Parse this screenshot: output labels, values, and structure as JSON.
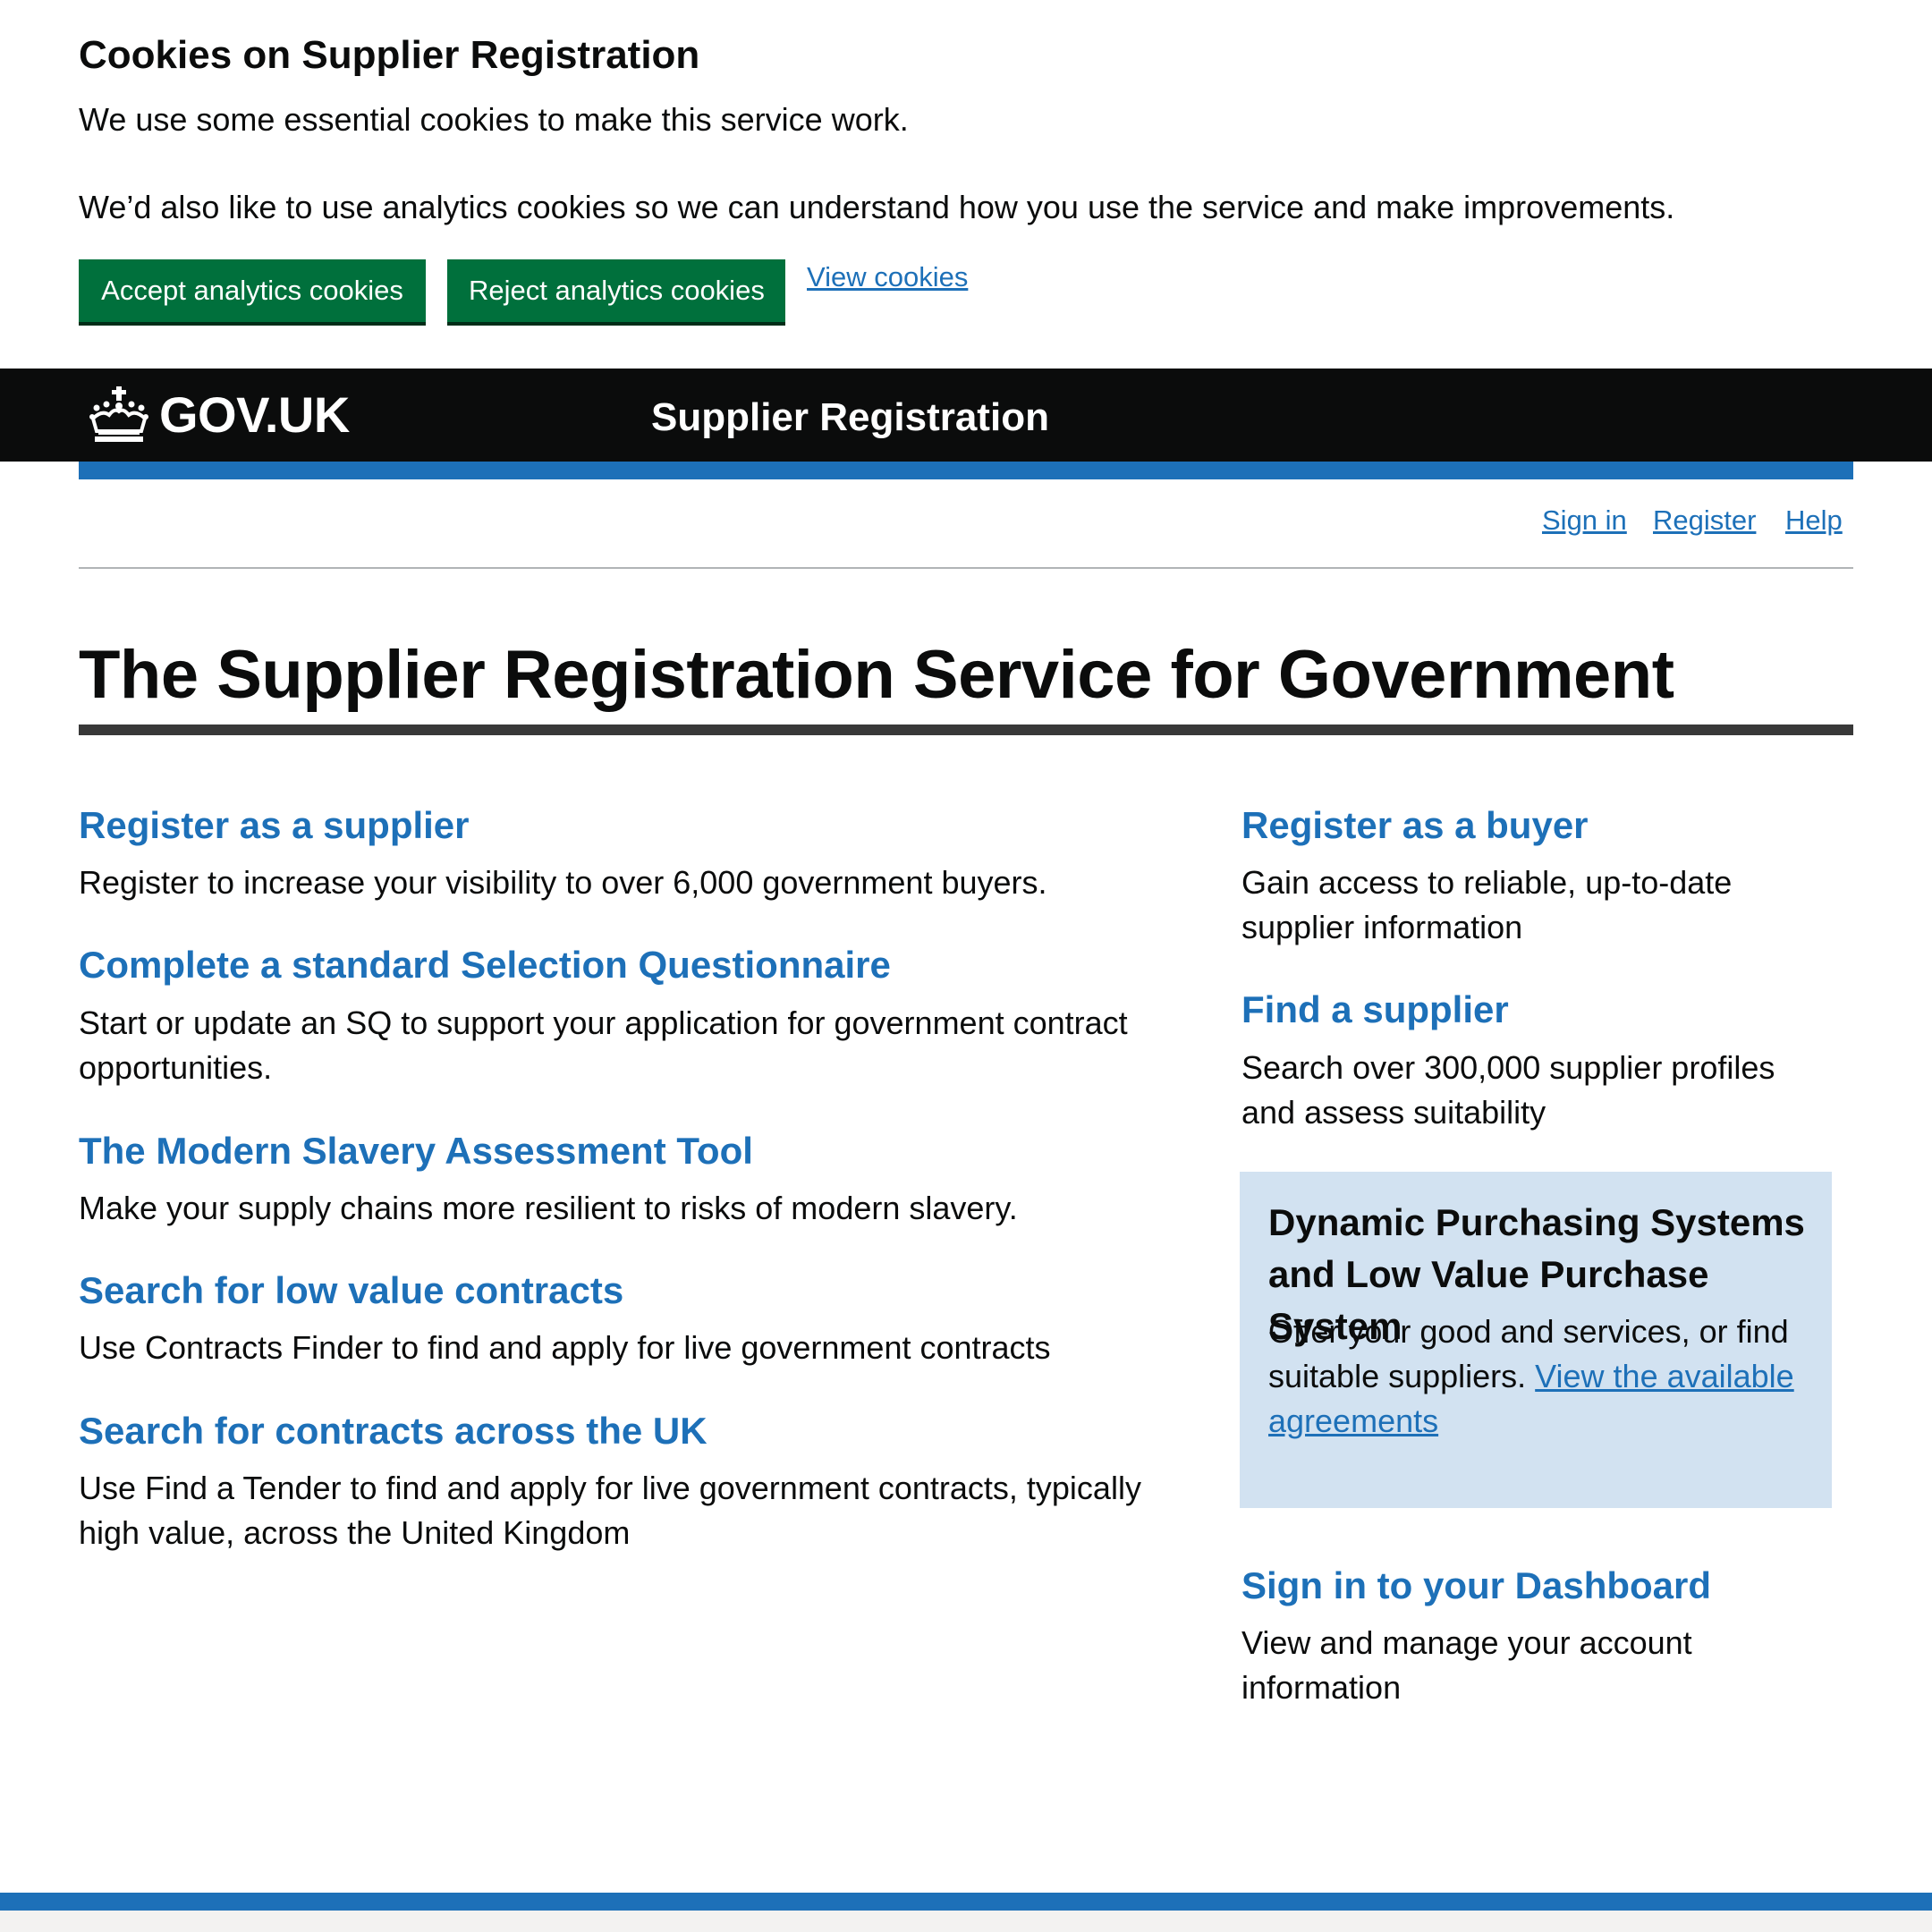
{
  "cookie_banner": {
    "title": "Cookies on Supplier Registration",
    "paragraph_1": "We use some essential cookies to make this service work.",
    "paragraph_2": "We’d also like to use analytics cookies so we can understand how you use the service and make improvements.",
    "accept_label": "Accept analytics cookies",
    "reject_label": "Reject analytics cookies",
    "view_label": "View cookies"
  },
  "header": {
    "logo_text": "GOV.UK",
    "logo_icon": "crown-icon",
    "service_name": "Supplier Registration"
  },
  "nav": {
    "sign_in": "Sign in",
    "register": "Register",
    "help": "Help"
  },
  "main": {
    "title": "The Supplier Registration Service for Government",
    "left": [
      {
        "heading": "Register as a supplier",
        "description": "Register to increase your visibility to over 6,000 government buyers."
      },
      {
        "heading": "Complete a standard Selection Questionnaire",
        "description_1": "Start or update an SQ to support your application for government contract",
        "description_2": "opportunities."
      },
      {
        "heading": "The Modern Slavery Assessment Tool",
        "description": "Make your supply chains more resilient to risks of modern slavery."
      },
      {
        "heading": "Search for low value contracts",
        "description": "Use Contracts Finder to find and apply for live government contracts"
      },
      {
        "heading": "Search for contracts across the UK",
        "description_1": "Use Find a Tender to find and apply for live government contracts, typically",
        "description_2": "high value, across the United Kingdom"
      }
    ],
    "right": [
      {
        "heading": "Register as a buyer",
        "description_1": "Gain access to reliable, up-to-date",
        "description_2": "supplier information"
      },
      {
        "heading": "Find a supplier",
        "description_1": "Search over 300,000 supplier profiles",
        "description_2": "and assess suitability"
      },
      {
        "heading": "Sign in to your Dashboard",
        "description_1": "View and manage your account",
        "description_2": "information"
      }
    ],
    "dps_panel": {
      "title": "Dynamic Purchasing Systems and Low Value Purchase System",
      "text": "Offer your good and services, or find suitable suppliers. ",
      "link": "View the available agreements"
    }
  },
  "colors": {
    "link": "#1d70b8",
    "button_green": "#00703c",
    "header_black": "#0b0c0c",
    "brand_blue": "#1d70b8",
    "panel_blue": "#d2e2f1"
  }
}
